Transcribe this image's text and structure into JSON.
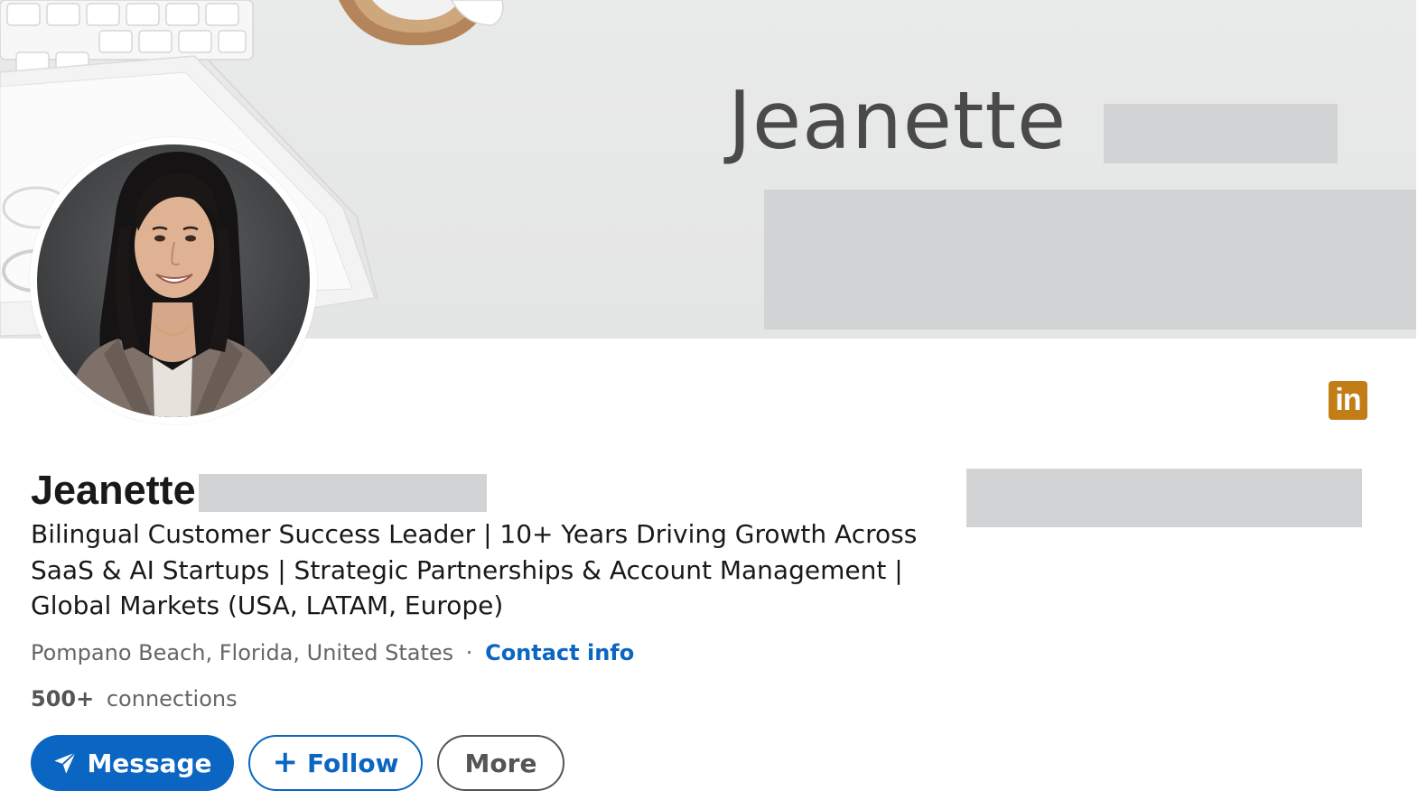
{
  "banner": {
    "first_name": "Jeanette"
  },
  "profile": {
    "first_name": "Jeanette",
    "headline": "Bilingual Customer Success Leader | 10+ Years Driving Growth Across SaaS & AI Startups | Strategic Partnerships & Account Management | Global Markets (USA, LATAM, Europe)",
    "location": "Pompano Beach, Florida, United States",
    "separator": "·",
    "contact_info_label": "Contact info",
    "connections_count": "500+",
    "connections_label": "connections"
  },
  "brand": {
    "logo_text": "in",
    "logo_color": "#c37d16",
    "accent": "#0a66c2"
  },
  "actions": {
    "message_label": "Message",
    "follow_label": "Follow",
    "follow_prefix": "+",
    "more_label": "More"
  },
  "icons": {
    "message": "send-icon",
    "follow": "plus-icon",
    "brand": "linkedin-icon"
  }
}
